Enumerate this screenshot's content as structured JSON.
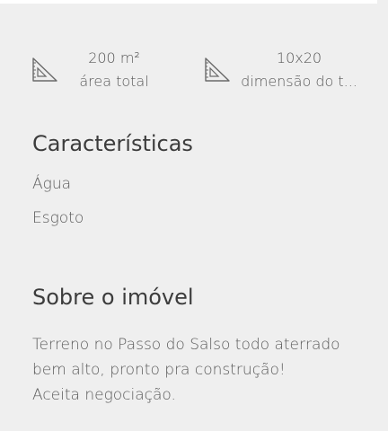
{
  "features": [
    {
      "icon": "ruler-triangle-icon",
      "value": "200 m²",
      "label": "área total"
    },
    {
      "icon": "ruler-triangle-icon",
      "value": "10x20",
      "label": "dimensão do t..."
    }
  ],
  "characteristics": {
    "title": "Características",
    "items": [
      "Água",
      "Esgoto"
    ]
  },
  "about": {
    "title": "Sobre o imóvel",
    "lines": [
      "Terreno no Passo do Salso todo aterrado",
      "bem alto, pronto pra construção!",
      "Aceita negociação."
    ]
  }
}
